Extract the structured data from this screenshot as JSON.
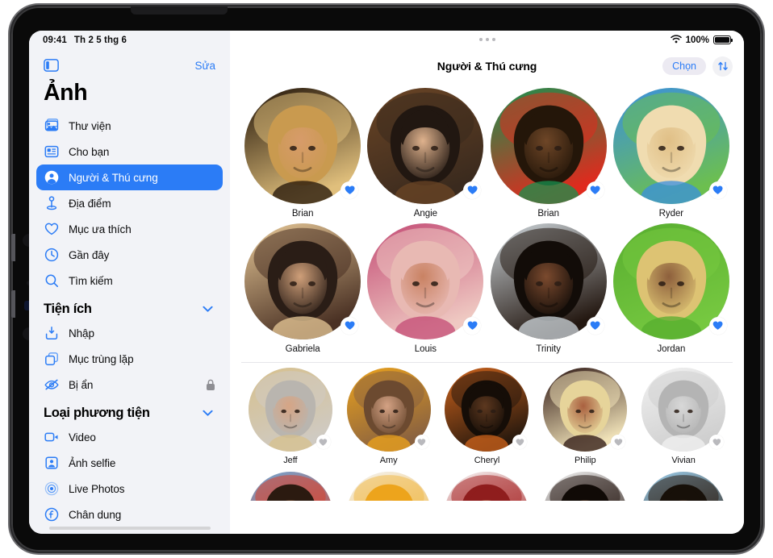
{
  "status_bar": {
    "time": "09:41",
    "date": "Th 2 5 thg 6",
    "wifi_icon": "wifi-icon",
    "battery_percent": "100%",
    "battery_icon": "battery-full-icon"
  },
  "sidebar": {
    "toggle_icon": "sidebar-toggle-icon",
    "edit_label": "Sửa",
    "app_title": "Ảnh",
    "primary_items": [
      {
        "label": "Thư viện",
        "icon": "photos-library-icon",
        "selected": false
      },
      {
        "label": "Cho bạn",
        "icon": "for-you-icon",
        "selected": false
      },
      {
        "label": "Người & Thú cưng",
        "icon": "people-pets-icon",
        "selected": true
      },
      {
        "label": "Địa điểm",
        "icon": "places-pin-icon",
        "selected": false
      },
      {
        "label": "Mục ưa thích",
        "icon": "heart-icon",
        "selected": false
      },
      {
        "label": "Gần đây",
        "icon": "clock-icon",
        "selected": false
      },
      {
        "label": "Tìm kiếm",
        "icon": "search-icon",
        "selected": false
      }
    ],
    "utilities_section": {
      "title": "Tiện ích",
      "chevron_icon": "chevron-down-icon",
      "items": [
        {
          "label": "Nhập",
          "icon": "import-icon",
          "trailing_icon": ""
        },
        {
          "label": "Mục trùng lặp",
          "icon": "duplicates-icon",
          "trailing_icon": ""
        },
        {
          "label": "Bị ẩn",
          "icon": "hidden-eye-icon",
          "trailing_icon": "lock-icon"
        }
      ]
    },
    "media_types_section": {
      "title": "Loại phương tiện",
      "chevron_icon": "chevron-down-icon",
      "items": [
        {
          "label": "Video",
          "icon": "video-icon"
        },
        {
          "label": "Ảnh selfie",
          "icon": "selfie-icon"
        },
        {
          "label": "Live Photos",
          "icon": "live-photos-icon"
        },
        {
          "label": "Chân dung",
          "icon": "portrait-icon"
        }
      ]
    }
  },
  "main": {
    "title": "Người & Thú cưng",
    "select_label": "Chọn",
    "sort_icon": "sort-arrows-icon",
    "window_dots_icon": "window-controls-icon",
    "rows": [
      {
        "size": "lg",
        "people": [
          {
            "name": "Brian",
            "favorite": true,
            "bg": "#1f1207",
            "skin": "#d79b6a",
            "hair": "#c99a4f",
            "hair2": "#e0bf7c"
          },
          {
            "name": "Angie",
            "favorite": true,
            "bg": "#6b4525",
            "skin": "#dfb28d",
            "hair": "#211711",
            "hair2": "#3a2a1e"
          },
          {
            "name": "Brian",
            "favorite": true,
            "bg": "#17924f",
            "skin": "#6e4627",
            "hair": "#241609",
            "hair2": "#e02a1d"
          },
          {
            "name": "Ryder",
            "favorite": true,
            "bg": "#3a8fe0",
            "skin": "#e0bf86",
            "hair": "#f0dcb0",
            "hair2": "#6cbf4f"
          }
        ]
      },
      {
        "size": "lg",
        "people": [
          {
            "name": "Gabriela",
            "favorite": true,
            "bg": "#e8c998",
            "skin": "#cf9f79",
            "hair": "#2a1d16",
            "hair2": "#4a3124"
          },
          {
            "name": "Louis",
            "favorite": true,
            "bg": "#c34a74",
            "skin": "#c98263",
            "hair": "#e8b9b3",
            "hair2": "#efc9c2"
          },
          {
            "name": "Trinity",
            "favorite": true,
            "bg": "#cfd7dc",
            "skin": "#7b4a2e",
            "hair": "#120c08",
            "hair2": "#231710"
          },
          {
            "name": "Jordan",
            "favorite": true,
            "bg": "#57ad2f",
            "skin": "#8d5f3c",
            "hair": "#ddc373",
            "hair2": "#76c840"
          }
        ]
      },
      {
        "size": "md",
        "people": [
          {
            "name": "Jeff",
            "favorite": false,
            "bg": "#d7c08c",
            "skin": "#d6a585",
            "hair": "#b9b5af",
            "hair2": "#cfcac2"
          },
          {
            "name": "Amy",
            "favorite": false,
            "bg": "#eda41c",
            "skin": "#d4a284",
            "hair": "#6c4a30",
            "hair2": "#8a6240"
          },
          {
            "name": "Cheryl",
            "favorite": false,
            "bg": "#d0641c",
            "skin": "#5d381f",
            "hair": "#150d07",
            "hair2": "#2a1a0e"
          },
          {
            "name": "Philip",
            "favorite": false,
            "bg": "#2b1412",
            "skin": "#a9603f",
            "hair": "#e6d49a",
            "hair2": "#f0e2b8"
          },
          {
            "name": "Vivian",
            "favorite": false,
            "bg": "#f2f2f2",
            "skin": "#d8d8d8",
            "hair": "#b4b4b4",
            "hair2": "#cfcfcf"
          }
        ]
      },
      {
        "size": "md",
        "partial": true,
        "people": [
          {
            "name": "",
            "favorite": false,
            "bg": "#6fa9d8",
            "skin": "#8a5a34",
            "hair": "#2b1a10",
            "hair2": "#d8412b"
          },
          {
            "name": "",
            "favorite": false,
            "bg": "#f5f5f5",
            "skin": "#d9a36f",
            "hair": "#eda41c",
            "hair2": "#f0b94a"
          },
          {
            "name": "",
            "favorite": false,
            "bg": "#fafafa",
            "skin": "#c58a62",
            "hair": "#8f1d1d",
            "hair2": "#a82626"
          },
          {
            "name": "",
            "favorite": false,
            "bg": "#fbfbfb",
            "skin": "#6b432a",
            "hair": "#100a06",
            "hair2": "#241610"
          },
          {
            "name": "",
            "favorite": false,
            "bg": "#9fd2f0",
            "skin": "#4f3220",
            "hair": "#171009",
            "hair2": "#2b1d12"
          }
        ]
      }
    ]
  }
}
